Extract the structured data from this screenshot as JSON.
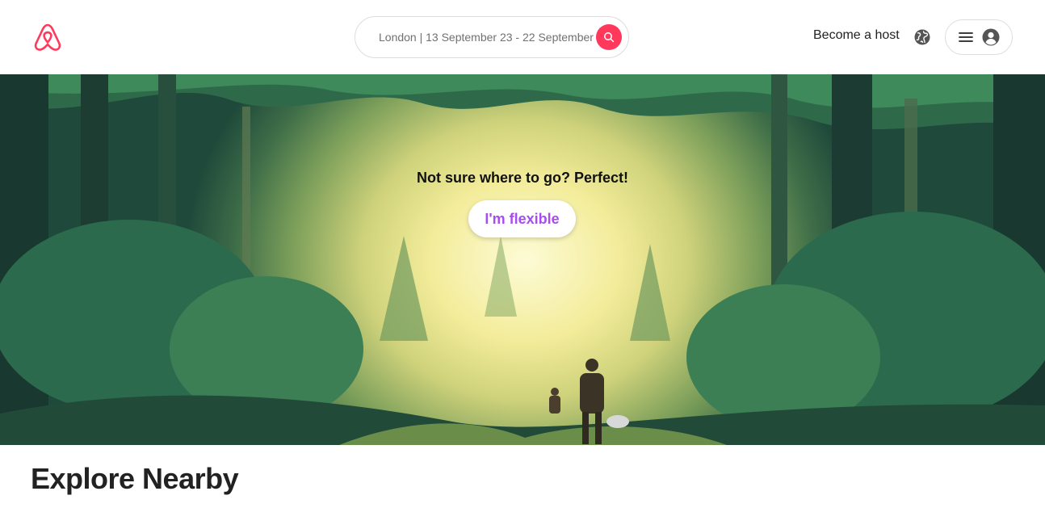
{
  "header": {
    "logo_icon": "airbnb-logo-icon",
    "search": {
      "value": "London | 13 September 23 - 22 September",
      "icon": "search-icon"
    },
    "host_link": "Become a host",
    "globe_icon": "globe-icon",
    "menu_icon": "hamburger-menu-icon",
    "avatar_icon": "user-avatar-icon"
  },
  "hero": {
    "headline": "Not sure where to go? Perfect!",
    "button_label": "I'm flexible"
  },
  "explore": {
    "title": "Explore Nearby"
  },
  "colors": {
    "brand": "#ff385c",
    "flexible_accent": "#a64df0",
    "text_primary": "#222222",
    "text_secondary": "#717171"
  }
}
